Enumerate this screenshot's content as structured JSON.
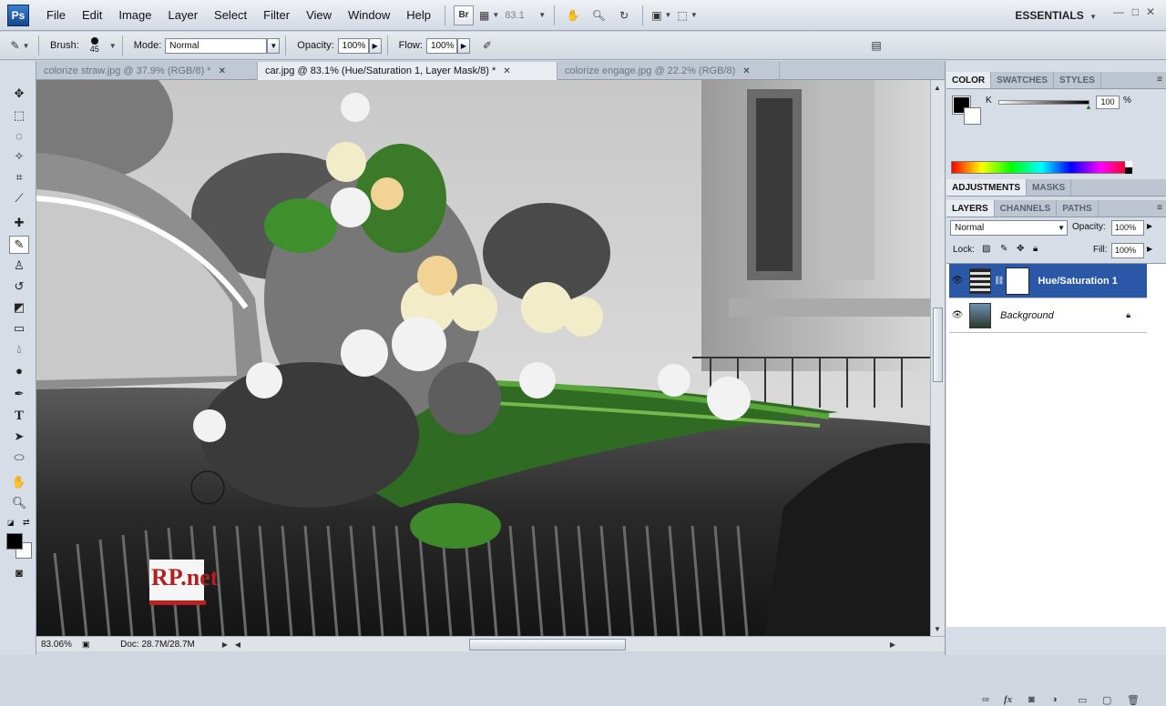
{
  "app": {
    "logo": "Ps",
    "workspace": "ESSENTIALS"
  },
  "menu": [
    "File",
    "Edit",
    "Image",
    "Layer",
    "Select",
    "Filter",
    "View",
    "Window",
    "Help"
  ],
  "menubar_tools": {
    "bridge_label": "Br",
    "zoom_value": "83.1"
  },
  "options": {
    "brush_label": "Brush:",
    "brush_size": "45",
    "mode_label": "Mode:",
    "mode_value": "Normal",
    "opacity_label": "Opacity:",
    "opacity_value": "100%",
    "flow_label": "Flow:",
    "flow_value": "100%"
  },
  "tabs": [
    {
      "label": "colorize straw.jpg @ 37.9% (RGB/8) *"
    },
    {
      "label": "car.jpg @ 83.1% (Hue/Saturation 1, Layer Mask/8) *"
    },
    {
      "label": "colorize engage.jpg @ 22.2% (RGB/8)"
    }
  ],
  "status": {
    "zoom": "83.06%",
    "doc": "Doc: 28.7M/28.7M"
  },
  "color_panel": {
    "tabs": [
      "COLOR",
      "SWATCHES",
      "STYLES"
    ],
    "channel": "K",
    "value": "100",
    "unit": "%"
  },
  "adjust_panel": {
    "tabs": [
      "ADJUSTMENTS",
      "MASKS"
    ]
  },
  "layers_panel": {
    "tabs": [
      "LAYERS",
      "CHANNELS",
      "PATHS"
    ],
    "blend_mode": "Normal",
    "opacity_label": "Opacity:",
    "opacity_value": "100%",
    "lock_label": "Lock:",
    "fill_label": "Fill:",
    "fill_value": "100%",
    "layers": [
      {
        "name": "Hue/Saturation 1"
      },
      {
        "name": "Background"
      }
    ]
  },
  "watermark": {
    "text": "RP.net"
  }
}
